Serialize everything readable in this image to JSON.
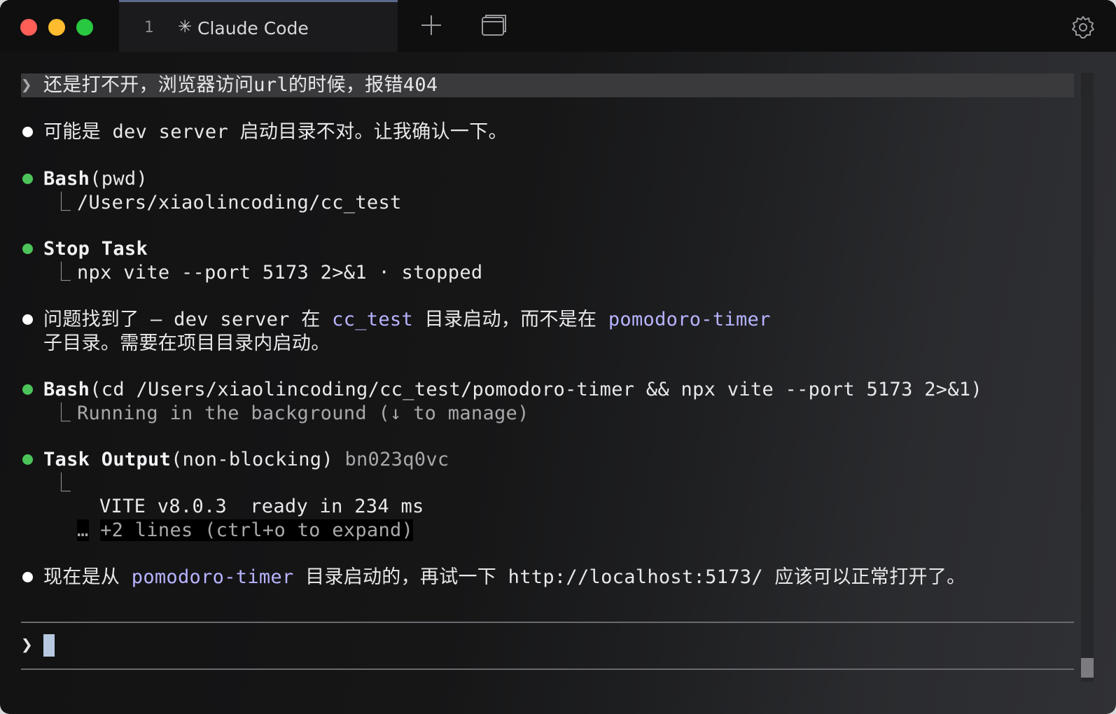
{
  "window": {
    "tab_number": "1",
    "tab_spark": "✳",
    "tab_title": "Claude Code"
  },
  "transcript": {
    "user_prompt": "还是打不开，浏览器访问url的时候，报错404",
    "msg1": "可能是 dev server 启动目录不对。让我确认一下。",
    "bash1": {
      "tool": "Bash",
      "args": "(pwd)",
      "output": "/Users/xiaolincoding/cc_test"
    },
    "stop": {
      "tool": "Stop Task",
      "output": "npx vite --port 5173 2>&1 · stopped"
    },
    "msg2": {
      "p1": "问题找到了 — dev server 在 ",
      "dir1": "cc_test",
      "p2": " 目录启动，而不是在 ",
      "dir2": "pomodoro-timer",
      "line2": "子目录。需要在项目目录内启动。"
    },
    "bash2": {
      "tool": "Bash",
      "args": "(cd /Users/xiaolincoding/cc_test/pomodoro-timer && npx vite --port 5173 2>&1)",
      "output": "Running in the background (↓ to manage)"
    },
    "task_output": {
      "tool": "Task Output",
      "args": "(non-blocking)",
      "id": " bn023q0vc",
      "vite_line": "VITE v8.0.3  ready in 234 ms",
      "ellipsis": "…",
      "expand": "+2 lines (ctrl+o to expand)"
    },
    "msg3": {
      "p1": "现在是从 ",
      "dir": "pomodoro-timer",
      "p2": " 目录启动的，再试一下 http://localhost:5173/ 应该可以正常打开了。"
    }
  },
  "input": {
    "prompt_symbol": "❯",
    "value": ""
  },
  "colors": {
    "accent_lavender": "#b7b4ff",
    "success_green": "#4cc45a",
    "cursor": "#b7c9e0"
  },
  "icons": [
    "new-tab-icon",
    "window-icon",
    "gear-icon"
  ]
}
